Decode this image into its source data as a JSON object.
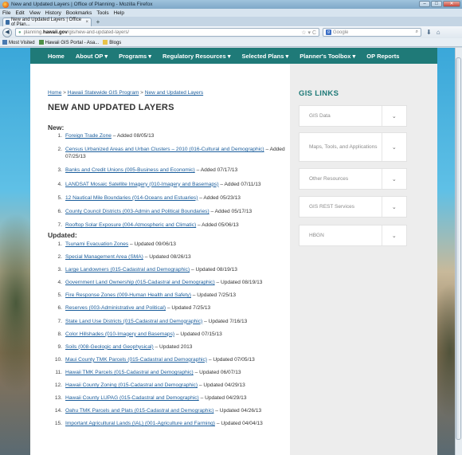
{
  "window": {
    "title": "New and Updated Layers | Office of Planning - Mozilla Firefox",
    "buttons": {
      "minimize": "–",
      "maximize": "□",
      "close": "✕"
    }
  },
  "menu": [
    "File",
    "Edit",
    "View",
    "History",
    "Bookmarks",
    "Tools",
    "Help"
  ],
  "tab": {
    "label": "New and Updated Layers | Office of Plan...",
    "close": "×",
    "new": "+"
  },
  "nav": {
    "back": "◀",
    "url_prefix": "planning.",
    "url_host": "hawaii.gov",
    "url_path": "/gis/new-and-updated-layers/",
    "url_icons": "☆ ▾ C",
    "search_engine": "g",
    "search_placeholder": "Google",
    "search_icon": "⌕",
    "download_icon": "⬇",
    "home_icon": "⌂"
  },
  "bookmarks": [
    "Most Visited",
    "Hawaii GIS Portal - Asa...",
    "Blogs"
  ],
  "site_nav": [
    "Home",
    "About OP  ▾",
    "Programs  ▾",
    "Regulatory Resources  ▾",
    "Selected Plans  ▾",
    "Planner's Toolbox  ▾",
    "OP Reports"
  ],
  "breadcrumb": {
    "home": "Home",
    "sep": " > ",
    "program": "Hawaii Statewide GIS Program",
    "current": "New and Updated Layers"
  },
  "page_title": "NEW AND UPDATED LAYERS",
  "new_heading": "New:",
  "new_items": [
    {
      "n": "1.",
      "link": "Foreign Trade Zone",
      "rest": " – Added 08/05/13"
    },
    {
      "n": "2.",
      "link": "Census Urbanized Areas and Urban Clusters – 2010 (016-Cultural and Demographic)",
      "rest": " – Added 07/25/13"
    },
    {
      "n": "3.",
      "link": "Banks and Credit Unions (005-Business and Economic)",
      "rest": " – Added 07/17/13"
    },
    {
      "n": "4.",
      "link": "LANDSAT Mosaic Satellite Imagery (010-Imagery and Basemaps)",
      "rest": " – Added 07/11/13"
    },
    {
      "n": "5.",
      "link": "12 Nautical Mile Boundaries (014-Oceans and Estuaries)",
      "rest": " – Added 05/23/13"
    },
    {
      "n": "6.",
      "link": "County Council Districts (003-Admin and Political Boundaries)",
      "rest": " – Added 05/17/13"
    },
    {
      "n": "7.",
      "link": "Rooftop Solar Exposure (004-Atmospheric and Climatic)",
      "rest": " – Added 05/06/13"
    }
  ],
  "updated_heading": "Updated:",
  "updated_items": [
    {
      "n": "1.",
      "link": "Tsunami Evacuation Zones",
      "rest": " – Updated 09/06/13"
    },
    {
      "n": "2.",
      "link": "Special Management Area (SMA)",
      "rest": " – Updated 08/26/13"
    },
    {
      "n": "3.",
      "link": "Large Landowners (015-Cadastral and Demographic)",
      "rest": " – Updated 08/19/13"
    },
    {
      "n": "4.",
      "link": "Government Land Ownership (015-Cadastral and Demographic)",
      "rest": " – Updated 08/19/13"
    },
    {
      "n": "5.",
      "link": "Fire Response Zones (009-Human Health and Safety)",
      "rest": " – Updated 7/25/13"
    },
    {
      "n": "6.",
      "link": "Reserves (003-Administrative and Political)",
      "rest": " – Updated 7/25/13"
    },
    {
      "n": "7.",
      "link": "State Land Use Districts (015-Cadastral and Demographic)",
      "rest": " – Updated 7/16/13"
    },
    {
      "n": "8.",
      "link": "Color Hillshades (010-Imagery and Basemaps)",
      "rest": " – Updated 07/15/13"
    },
    {
      "n": "9.",
      "link": "Soils (008-Geologic and Geophysical)",
      "rest": " – Updated 2013"
    },
    {
      "n": "10.",
      "link": "Maui County TMK Parcels (015-Cadastral and Demographic)",
      "rest": " – Updated 07/05/13"
    },
    {
      "n": "11.",
      "link": "Hawaii TMK Parcels (015-Cadastral and Demographic)",
      "rest": " – Updated 06/07/13"
    },
    {
      "n": "12.",
      "link": "Hawaii County Zoning (015-Cadastral and Demographic)",
      "rest": " – Updated 04/29/13"
    },
    {
      "n": "13.",
      "link": "Hawaii County LUPAG (015-Cadastral and Demographic)",
      "rest": " – Updated 04/29/13"
    },
    {
      "n": "14.",
      "link": "Oahu TMK Parcels and Plats (015-Cadastral and Demographic)",
      "rest": " – Updated 04/26/13"
    },
    {
      "n": "15.",
      "link": "Important Agricultural Lands (IAL) (001-Agriculture and Farming)",
      "rest": " – Updated 04/04/13"
    }
  ],
  "sidebar": {
    "heading": "GIS LINKS",
    "chevron": "⌄",
    "items": [
      "GIS Data",
      "Maps, Tools, and Applications",
      "Other Resources",
      "GIS REST Services",
      "HBGN"
    ]
  },
  "colors": {
    "site_nav": "#1f7a78",
    "link": "#1a5d9c",
    "sidebar_heading": "#1f7a78"
  }
}
